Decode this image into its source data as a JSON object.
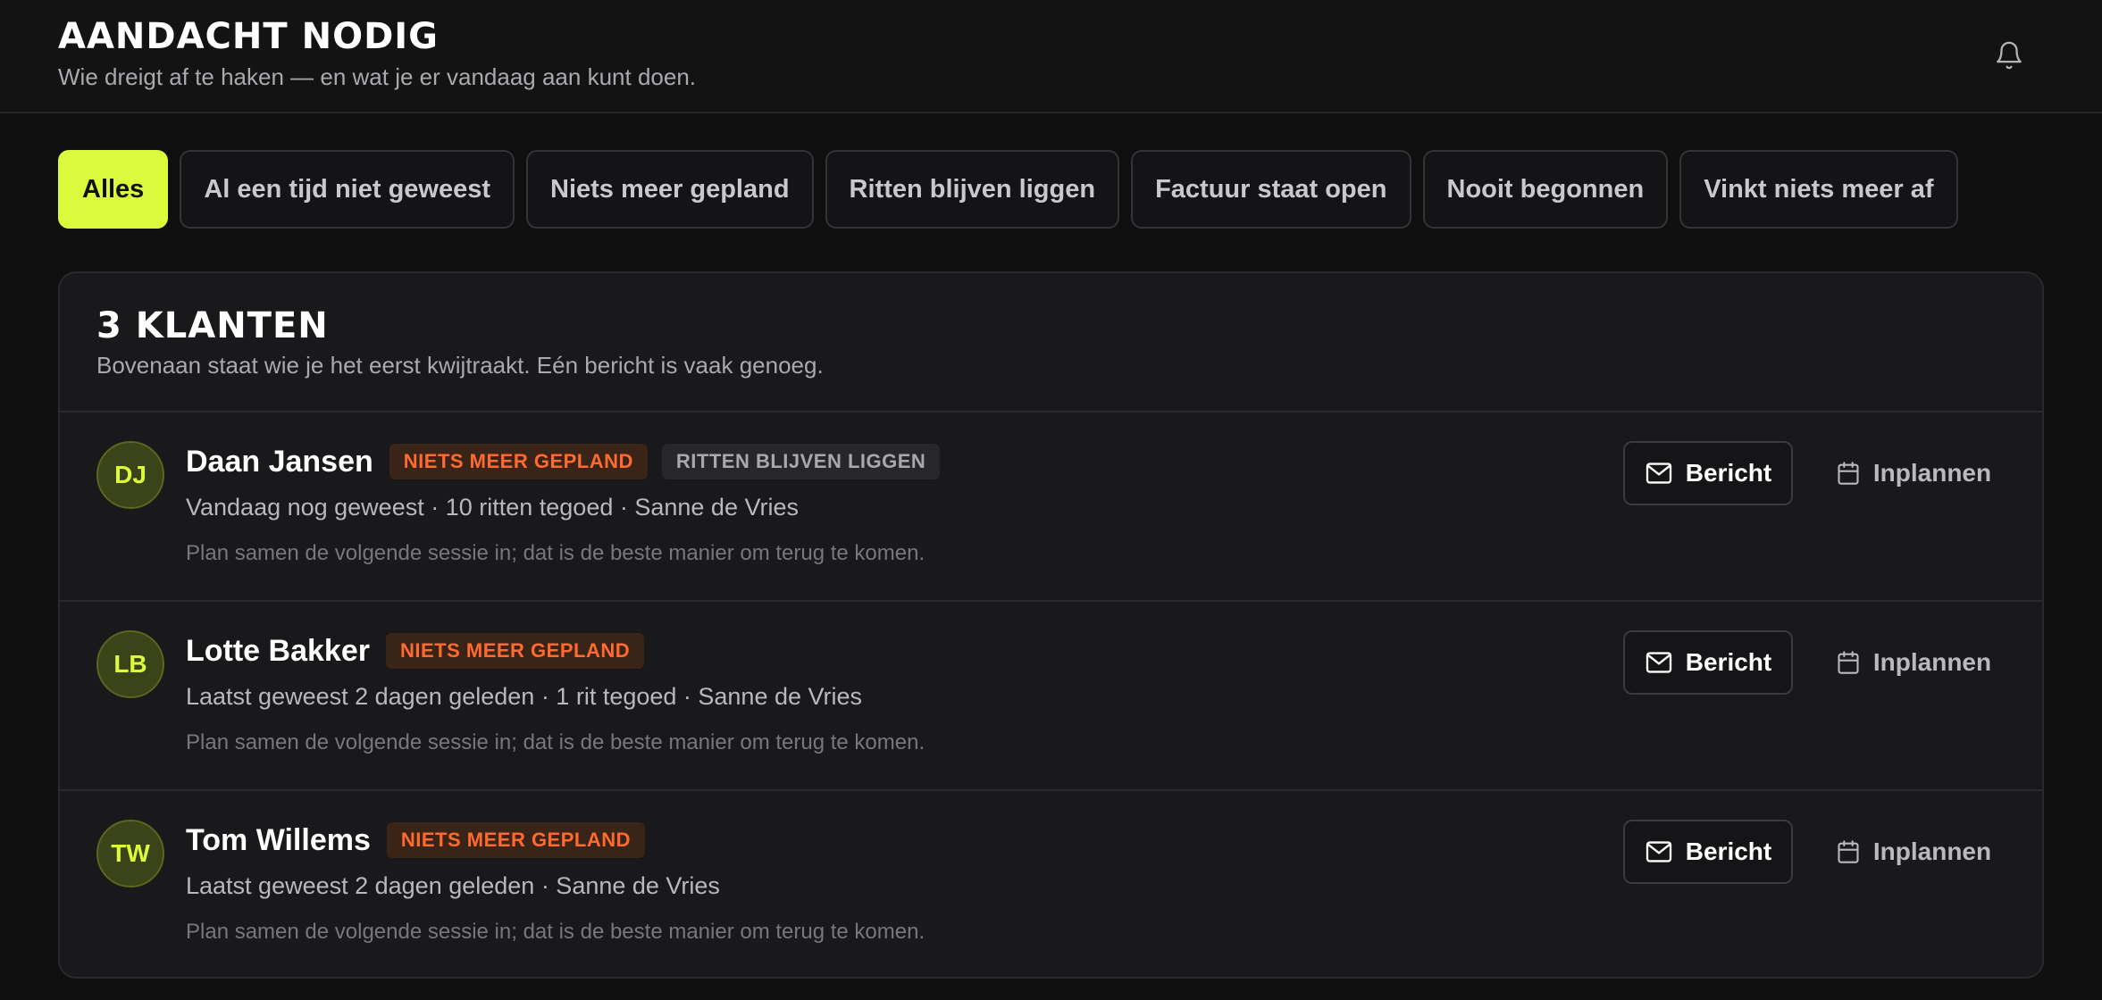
{
  "header": {
    "title": "AANDACHT NODIG",
    "subtitle": "Wie dreigt af te haken — en wat je er vandaag aan kunt doen."
  },
  "filters": [
    {
      "label": "Alles",
      "active": true
    },
    {
      "label": "Al een tijd niet geweest",
      "active": false
    },
    {
      "label": "Niets meer gepland",
      "active": false
    },
    {
      "label": "Ritten blijven liggen",
      "active": false
    },
    {
      "label": "Factuur staat open",
      "active": false
    },
    {
      "label": "Nooit begonnen",
      "active": false
    },
    {
      "label": "Vinkt niets meer af",
      "active": false
    }
  ],
  "list": {
    "title": "3 KLANTEN",
    "subtitle": "Bovenaan staat wie je het eerst kwijtraakt. Eén bericht is vaak genoeg.",
    "message_label": "Bericht",
    "schedule_label": "Inplannen",
    "clients": [
      {
        "initials": "DJ",
        "name": "Daan Jansen",
        "badges": [
          {
            "label": "NIETS MEER GEPLAND",
            "tone": "orange"
          },
          {
            "label": "RITTEN BLIJVEN LIGGEN",
            "tone": "gray"
          }
        ],
        "meta": "Vandaag nog geweest · 10 ritten tegoed · Sanne de Vries",
        "hint": "Plan samen de volgende sessie in; dat is de beste manier om terug te komen."
      },
      {
        "initials": "LB",
        "name": "Lotte Bakker",
        "badges": [
          {
            "label": "NIETS MEER GEPLAND",
            "tone": "orange"
          }
        ],
        "meta": "Laatst geweest 2 dagen geleden · 1 rit tegoed · Sanne de Vries",
        "hint": "Plan samen de volgende sessie in; dat is de beste manier om terug te komen."
      },
      {
        "initials": "TW",
        "name": "Tom Willems",
        "badges": [
          {
            "label": "NIETS MEER GEPLAND",
            "tone": "orange"
          }
        ],
        "meta": "Laatst geweest 2 dagen geleden · Sanne de Vries",
        "hint": "Plan samen de volgende sessie in; dat is de beste manier om terug te komen."
      }
    ]
  },
  "colors": {
    "accent": "#dcfb3c",
    "warning": "#ff6b2e",
    "background": "#0f0f10",
    "card": "#19191b"
  },
  "icons": {
    "header": "bell-icon",
    "message": "mail-icon",
    "schedule": "calendar-icon"
  }
}
